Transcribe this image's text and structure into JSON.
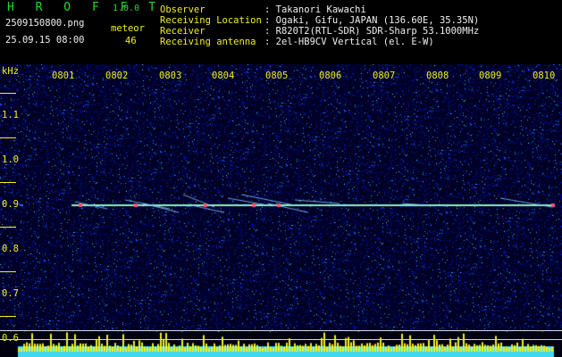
{
  "app": {
    "name": "H R O F F T",
    "version": "1.0.0"
  },
  "file": {
    "name": "2509150800.png",
    "datetime": "25.09.15 08:00"
  },
  "meteor": {
    "label": "meteor",
    "count": "46"
  },
  "info": {
    "observer_label": "Observer",
    "observer_value": ": Takanori Kawachi",
    "location_label": "Receiving Location",
    "location_value": ": Ogaki, Gifu, JAPAN (136.60E, 35.35N)",
    "receiver_label": "Receiver",
    "receiver_value": ": R820T2(RTL-SDR) SDR-Sharp 53.1000MHz",
    "antenna_label": "Receiving antenna",
    "antenna_value": ": 2el-HB9CV Vertical (el. E-W)"
  },
  "axis": {
    "y_unit": "kHz",
    "y_ticks": [
      "1.1",
      "1.0",
      "0.9",
      "0.8",
      "0.7",
      "0.6"
    ],
    "x_ticks": [
      "0801",
      "0802",
      "0803",
      "0804",
      "0805",
      "0806",
      "0807",
      "0808",
      "0809",
      "0810"
    ]
  },
  "colors": {
    "label": "#f0f020",
    "logo": "#27d827",
    "background": "#000010",
    "carrier": "#8ff0c0",
    "bars": "#f0f020"
  }
}
